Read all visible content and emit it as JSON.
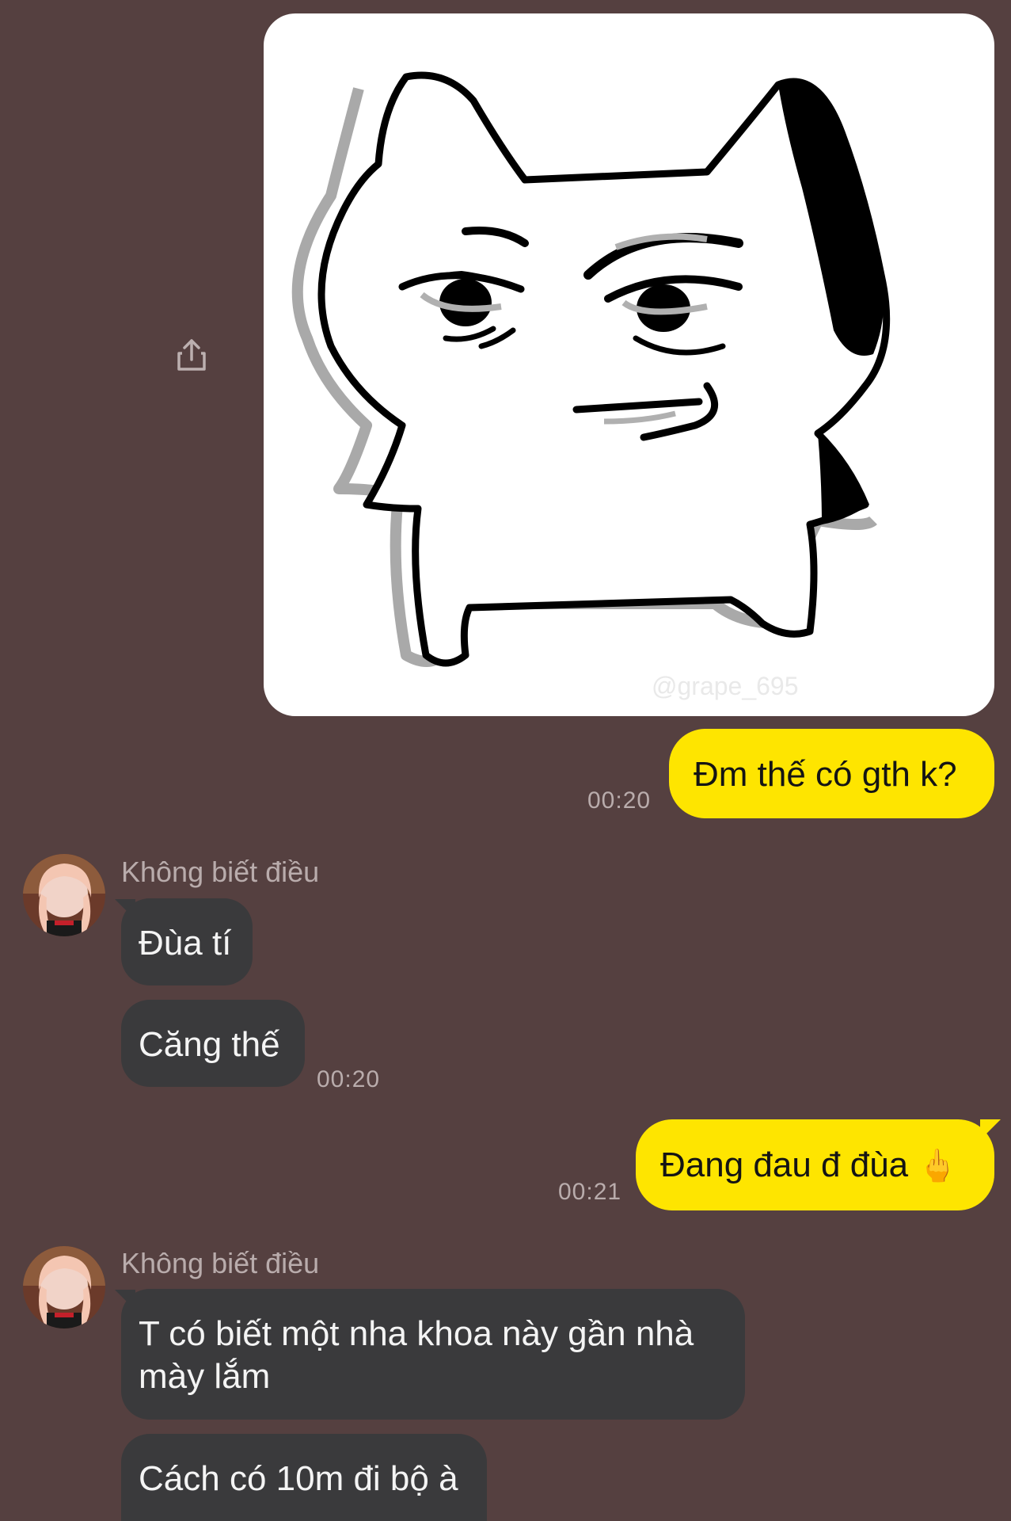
{
  "colors": {
    "background": "#554040",
    "my_bubble": "#fee500",
    "their_bubble": "#3a3a3c",
    "timestamp": "#b9acac"
  },
  "conversation": {
    "sticker": {
      "watermark": "@grape_695",
      "share_icon": "share-icon"
    },
    "messages": [
      {
        "side": "me",
        "text": "Đm thế có gth k?",
        "time": "00:20"
      },
      {
        "side": "them",
        "sender": "Không biết điều",
        "bubbles": [
          "Đùa tí",
          "Căng thế"
        ],
        "time": "00:20"
      },
      {
        "side": "me",
        "text": "Đang đau đ đùa",
        "emoji": "🖕",
        "time": "00:21"
      },
      {
        "side": "them",
        "sender": "Không biết điều",
        "bubbles": [
          "T có biết một nha khoa này gần nhà",
          "mày lắm",
          "Cách có 10m đi bộ à"
        ]
      }
    ]
  }
}
